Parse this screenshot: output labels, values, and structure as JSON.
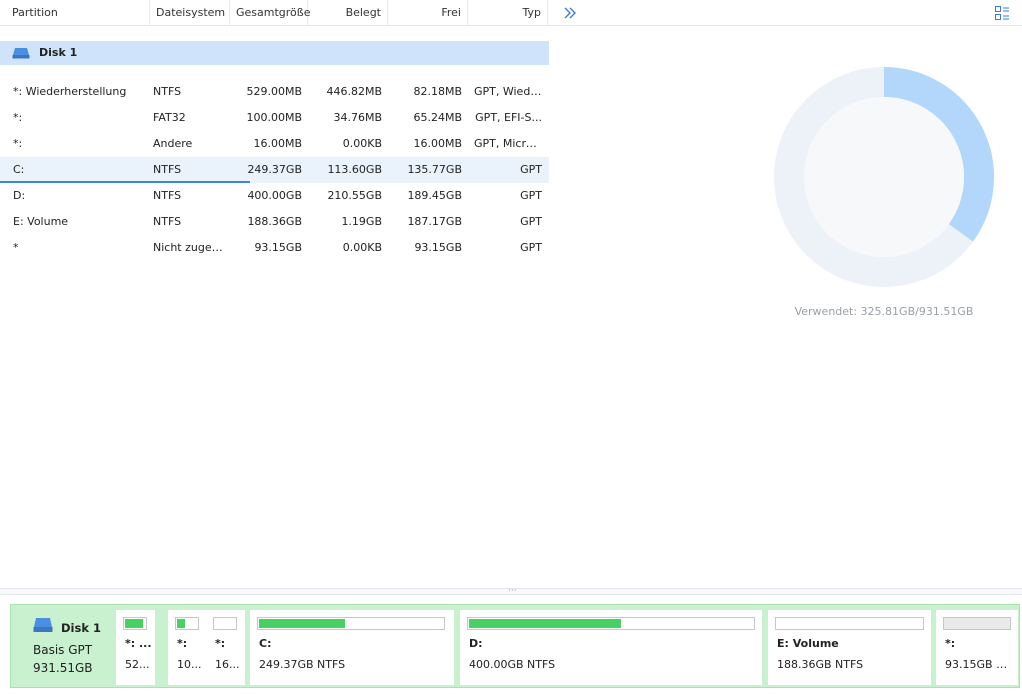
{
  "columns": {
    "partition": "Partition",
    "filesystem": "Dateisystem",
    "total": "Gesamtgröße",
    "used": "Belegt",
    "free": "Frei",
    "type": "Typ"
  },
  "icons": {
    "more": "double-chevron-right-icon",
    "layout": "layout-toggle-icon",
    "disk": "hard-disk-icon"
  },
  "disk": {
    "label": "Disk 1"
  },
  "partitions": [
    {
      "name": "*: Wiederherstellung",
      "fs": "NTFS",
      "total": "529.00MB",
      "used": "446.82MB",
      "free": "82.18MB",
      "type": "GPT, Wiede..."
    },
    {
      "name": "*:",
      "fs": "FAT32",
      "total": "100.00MB",
      "used": "34.76MB",
      "free": "65.24MB",
      "type": "GPT, EFI-S..."
    },
    {
      "name": "*:",
      "fs": "Andere",
      "total": "16.00MB",
      "used": "0.00KB",
      "free": "16.00MB",
      "type": "GPT, Micros..."
    },
    {
      "name": "C:",
      "fs": "NTFS",
      "total": "249.37GB",
      "used": "113.60GB",
      "free": "135.77GB",
      "type": "GPT"
    },
    {
      "name": "D:",
      "fs": "NTFS",
      "total": "400.00GB",
      "used": "210.55GB",
      "free": "189.45GB",
      "type": "GPT"
    },
    {
      "name": "E: Volume",
      "fs": "NTFS",
      "total": "188.36GB",
      "used": "1.19GB",
      "free": "187.17GB",
      "type": "GPT"
    },
    {
      "name": "*",
      "fs": "Nicht zugeor...",
      "total": "93.15GB",
      "used": "0.00KB",
      "free": "93.15GB",
      "type": "GPT"
    }
  ],
  "usage": {
    "caption": "Verwendet: 325.81GB/931.51GB",
    "used_fraction": 0.35
  },
  "colors": {
    "donut_used": "#b3d7fb",
    "donut_free": "#edf2f9",
    "bar_fill": "#47d163",
    "map_bg": "#c9f0cf",
    "selection": "#eaf2fc",
    "disk_row": "#cfe3fb"
  },
  "diskmap": {
    "name": "Disk 1",
    "type": "Basis GPT",
    "size": "931.51GB",
    "blocks": [
      {
        "name": "*: ...",
        "desc": "52...",
        "fill": 0.84
      },
      {
        "name": "*:",
        "desc": "10...",
        "fill": 0.35
      },
      {
        "name": "*:",
        "desc": "16...",
        "fill": 0.0
      },
      {
        "name": "C:",
        "desc": "249.37GB NTFS",
        "fill": 0.46
      },
      {
        "name": "D:",
        "desc": "400.00GB NTFS",
        "fill": 0.53
      },
      {
        "name": "E: Volume",
        "desc": "188.36GB NTFS",
        "fill": 0.0
      },
      {
        "name": "*:",
        "desc": "93.15GB Ni...",
        "fill": 0.0
      }
    ]
  }
}
